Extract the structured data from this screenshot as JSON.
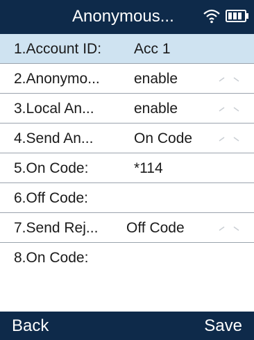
{
  "header": {
    "title": "Anonymous...",
    "wifi_icon": "wifi-icon",
    "battery_icon": "battery-icon"
  },
  "rows": [
    {
      "label": "1.Account ID:",
      "value": "Acc 1",
      "selected": true,
      "has_selector": false
    },
    {
      "label": "2.Anonymo...",
      "value": "enable",
      "selected": false,
      "has_selector": true
    },
    {
      "label": "3.Local An...",
      "value": "enable",
      "selected": false,
      "has_selector": true
    },
    {
      "label": "4.Send An...",
      "value": "On Code",
      "selected": false,
      "has_selector": true
    },
    {
      "label": "5.On Code:",
      "value": "*114",
      "selected": false,
      "has_selector": false
    },
    {
      "label": "6.Off Code:",
      "value": "",
      "selected": false,
      "has_selector": false
    },
    {
      "label": "7.Send Rej...",
      "value": "Off Code",
      "selected": false,
      "has_selector": true
    },
    {
      "label": "8.On Code:",
      "value": "",
      "selected": false,
      "has_selector": false
    }
  ],
  "softkeys": {
    "left": "Back",
    "right": "Save"
  },
  "colors": {
    "bar_background": "#0e2a4a",
    "selected_row": "#cfe3f1",
    "divider": "#9aa3ad"
  }
}
